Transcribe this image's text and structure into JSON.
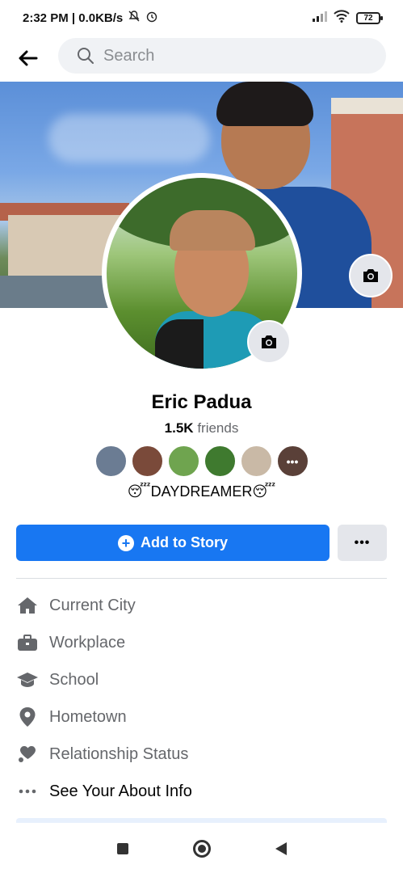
{
  "status_bar": {
    "time_speed": "2:32 PM | 0.0KB/s",
    "battery": "72"
  },
  "search": {
    "placeholder": "Search"
  },
  "profile": {
    "name": "Eric Padua",
    "friends_count": "1.5K",
    "friends_label": "friends",
    "bio": "😴DAYDREAMER😴"
  },
  "friend_avatar_colors": [
    "#6b7c93",
    "#7a4a3a",
    "#6fa44f",
    "#3f7a2f",
    "#c9b9a6",
    "#5a4038"
  ],
  "actions": {
    "add_story_label": "Add to Story",
    "more_label": "•••"
  },
  "details": {
    "current_city": "Current City",
    "workplace": "Workplace",
    "school": "School",
    "hometown": "Hometown",
    "relationship_status": "Relationship Status",
    "see_about": "See Your About Info"
  },
  "colors": {
    "accent": "#1877f2",
    "icon_gray": "#65676b"
  }
}
